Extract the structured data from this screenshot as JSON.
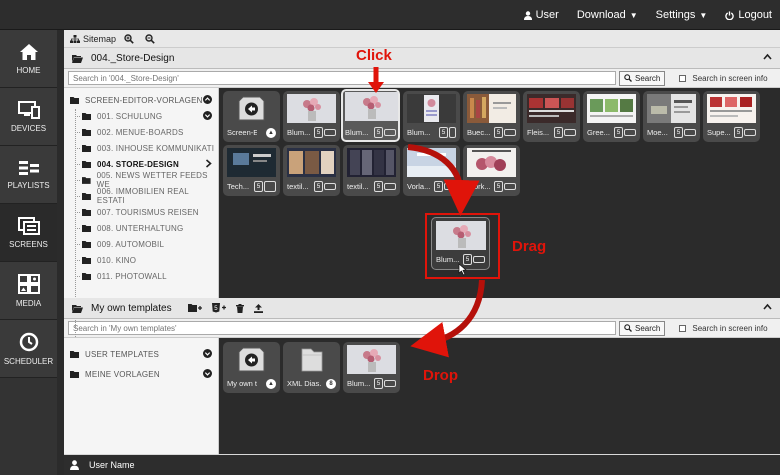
{
  "topnav": {
    "user": "User",
    "download": "Download",
    "settings": "Settings",
    "logout": "Logout"
  },
  "sidebar": {
    "items": [
      {
        "label": "HOME",
        "icon": "home-icon"
      },
      {
        "label": "DEVICES",
        "icon": "devices-icon"
      },
      {
        "label": "PLAYLISTS",
        "icon": "playlists-icon"
      },
      {
        "label": "SCREENS",
        "icon": "screens-icon"
      },
      {
        "label": "MEDIA",
        "icon": "media-icon"
      },
      {
        "label": "SCHEDULER",
        "icon": "clock-icon"
      }
    ],
    "active": "SCREENS"
  },
  "toolbar": {
    "sitemap": "Sitemap"
  },
  "top_panel": {
    "title": "004._Store-Design",
    "search_placeholder": "Search in '004._Store-Design'",
    "search_button": "Search",
    "screen_info_label": "Search in screen info",
    "tree": {
      "root": "SCREEN-EDITOR-VORLAGEN",
      "children": [
        "001. SCHULUNG",
        "002. MENUE-BOARDS",
        "003. INHOUSE KOMMUNIKATI",
        "004. STORE-DESIGN",
        "005. NEWS WETTER FEEDS WE",
        "006. IMMOBILIEN REAL ESTATI",
        "007. TOURISMUS REISEN",
        "008. UNTERHALTUNG",
        "009. AUTOMOBIL",
        "010. KINO",
        "011. PHOTOWALL"
      ],
      "selected": "004. STORE-DESIGN"
    },
    "tiles": [
      {
        "label": "Screen-E...",
        "kind": "back"
      },
      {
        "label": "Blum...",
        "kind": "flowers"
      },
      {
        "label": "Blum...",
        "kind": "flowers",
        "highlighted": true
      },
      {
        "label": "Blum...",
        "kind": "portrait"
      },
      {
        "label": "Buec...",
        "kind": "books"
      },
      {
        "label": "Fleis...",
        "kind": "meat"
      },
      {
        "label": "Gree...",
        "kind": "green"
      },
      {
        "label": "Moe...",
        "kind": "furniture"
      },
      {
        "label": "Supe...",
        "kind": "market"
      },
      {
        "label": "Tech...",
        "kind": "tech"
      },
      {
        "label": "textil...",
        "kind": "textile"
      },
      {
        "label": "textil...",
        "kind": "textile2"
      },
      {
        "label": "Vorla...",
        "kind": "vorla"
      },
      {
        "label": "Work...",
        "kind": "workshop"
      }
    ]
  },
  "bottom_panel": {
    "title": "My own templates",
    "search_placeholder": "Search in 'My own templates'",
    "search_button": "Search",
    "screen_info_label": "Search in screen info",
    "tree": [
      "USER TEMPLATES",
      "MEINE VORLAGEN"
    ],
    "tiles": [
      {
        "label": "My own t...",
        "kind": "back"
      },
      {
        "label": "XML Dias...",
        "kind": "folder",
        "count": "8"
      },
      {
        "label": "Blum...",
        "kind": "flowers"
      }
    ]
  },
  "drag_tile": {
    "label": "Blum..."
  },
  "annotations": {
    "click": "Click",
    "drag": "Drag",
    "drop": "Drop"
  },
  "statusbar": {
    "user_name": "User Name"
  },
  "colors": {
    "annotation": "#e0140a",
    "dark_bg": "#2b2b2b",
    "panel_bg": "#e6e6e6"
  }
}
